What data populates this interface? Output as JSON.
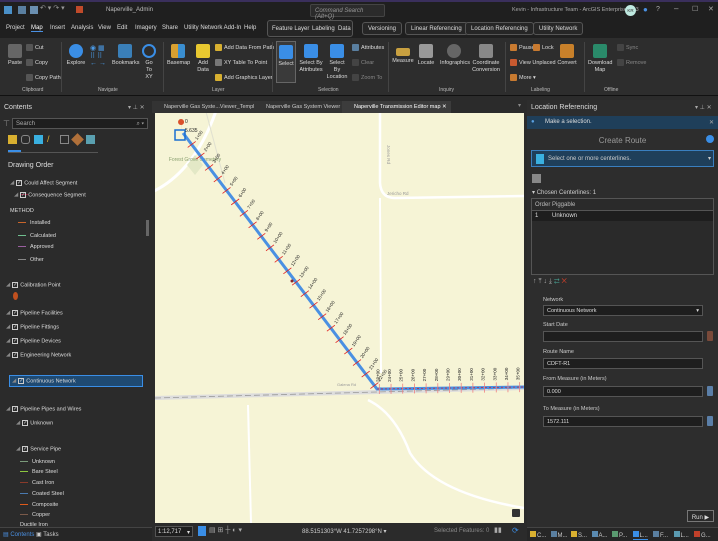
{
  "titlebar": {
    "project": "Naperville_Admin",
    "search_placeholder": "Command Search (Alt+Q)",
    "user": "Kevin - Infrastructure Team - ArcGIS Enterprise 11.3",
    "avatar": "KR",
    "help": "?"
  },
  "menu": [
    "Project",
    "Map",
    "Insert",
    "Analysis",
    "View",
    "Edit",
    "Imagery",
    "Share",
    "Utility Network Add-In",
    "Help"
  ],
  "context_tabs": [
    "Feature Layer",
    "Labeling",
    "Data",
    "Versioning",
    "Linear Referencing",
    "Location Referencing",
    "Utility Network"
  ],
  "ribbon": {
    "clipboard": {
      "paste": "Paste",
      "cut": "Cut",
      "copy": "Copy",
      "copy_path": "Copy Path",
      "group": "Clipboard"
    },
    "navigate": {
      "explore": "Explore",
      "bookmarks": "Bookmarks",
      "goto": "Go To XY",
      "group": "Navigate"
    },
    "layer": {
      "basemap": "Basemap",
      "add_data": "Add Data",
      "add_from_path": "Add Data From Path",
      "xy_table": "XY Table To Point",
      "add_graphics": "Add Graphics Layer",
      "group": "Layer"
    },
    "selection": {
      "select": "Select",
      "by_attr": "Select By Attributes",
      "by_loc": "Select By Location",
      "attributes": "Attributes",
      "clear": "Clear",
      "zoom_to": "Zoom To",
      "group": "Selection"
    },
    "inquiry": {
      "measure": "Measure",
      "locate": "Locate",
      "infographics": "Infographics",
      "coord": "Coordinate Conversion",
      "group": "Inquiry"
    },
    "labeling": {
      "pause": "Pause",
      "lock": "Lock",
      "view_unplaced": "View Unplaced",
      "more": "More",
      "convert": "Convert",
      "group": "Labeling"
    },
    "offline": {
      "download": "Download Map",
      "sync": "Sync",
      "remove": "Remove",
      "group": "Offline"
    }
  },
  "contents": {
    "title": "Contents",
    "search_placeholder": "Search",
    "drawing_order": "Drawing Order",
    "layers": [
      {
        "label": "Could Affect Segment",
        "checked": true,
        "swatch": "#8a1c3a"
      },
      {
        "label": "Consequence Segment",
        "checked": true
      },
      {
        "label": "METHOD",
        "heading": true
      },
      {
        "label": "Installed",
        "swatch": "#c8652a"
      },
      {
        "label": "Calculated",
        "swatch": "#6fbf8f"
      },
      {
        "label": "Approved",
        "swatch": "#9a5fa0"
      },
      {
        "label": "Other",
        "swatch": "#888888"
      },
      {
        "label": "Calibration Point",
        "checked": true
      },
      {
        "label": "Pipeline Facilities",
        "checked": true
      },
      {
        "label": "Pipeline Fittings",
        "checked": true
      },
      {
        "label": "Pipeline Devices",
        "checked": true
      },
      {
        "label": "Engineering Network",
        "checked": true
      },
      {
        "label": "Continuous Network",
        "checked": true,
        "selected": true
      },
      {
        "label": "Pipeline Pipes and Wires",
        "checked": true
      },
      {
        "label": "Unknown",
        "checked": true
      },
      {
        "label": "Service Pipe",
        "checked": true
      },
      {
        "label": "Unknown",
        "swatch": "#7a9a7a"
      },
      {
        "label": "Bare Steel",
        "swatch": "#8cc63f"
      },
      {
        "label": "Cast Iron",
        "swatch": "#8a3a2a"
      },
      {
        "label": "Coated Steel",
        "swatch": "#4a7ab0"
      },
      {
        "label": "Composite",
        "swatch": "#e05a1a"
      },
      {
        "label": "Copper",
        "swatch": "#7a5a4a"
      },
      {
        "label": "Ductile Iron"
      }
    ],
    "bottom_tabs": [
      "Contents",
      "Tasks"
    ]
  },
  "map_tabs": [
    "Naperville Gas Syste...Viewer_Template",
    "Naperville Gas System Viewer",
    "Naperville Transmission Editor map"
  ],
  "map": {
    "start_label": "0",
    "start_measure": "5.635",
    "cemetery": "Forest Grove Cemetery",
    "road1": "Jericho Rd",
    "road2": "Jones Rd",
    "road3": "Galena Rd",
    "stations": [
      "1+00",
      "2+00",
      "3+00",
      "4+00",
      "5+00",
      "6+00",
      "7+00",
      "8+00",
      "9+00",
      "10+00",
      "11+00",
      "12+00",
      "13+00",
      "14+00",
      "15+00",
      "16+00",
      "17+00",
      "18+00",
      "19+00",
      "20+00",
      "21+00",
      "22+00",
      "23+00",
      "24+00",
      "25+00",
      "26+00",
      "27+00",
      "28+00",
      "29+00",
      "30+00",
      "31+00",
      "32+00",
      "33+00",
      "34+00",
      "35+00"
    ]
  },
  "status": {
    "scale": "1:12,717",
    "coords": "88.5151303°W 41.7257298°N",
    "selected": "Selected Features: 0"
  },
  "lr": {
    "title": "Location Referencing",
    "info": "Make a selection.",
    "heading": "Create Route",
    "select_prompt": "Select one or more centerlines.",
    "chosen": "Chosen Centerlines: 1",
    "columns": [
      "Order",
      "Piggable"
    ],
    "rows": [
      [
        "1",
        "Unknown"
      ]
    ],
    "network_label": "Network",
    "network": "Continuous Network",
    "start_date_label": "Start Date",
    "start_date": "",
    "route_name_label": "Route Name",
    "route_name": "CDFT-R1",
    "from_label": "From Measure (in Meters)",
    "from": "0.000",
    "to_label": "To Measure (in Meters)",
    "to": "1572.111",
    "run": "Run",
    "bottom_tabs": [
      "C...",
      "M...",
      "S...",
      "A...",
      "P...",
      "L...",
      "F...",
      "L...",
      "G..."
    ]
  }
}
